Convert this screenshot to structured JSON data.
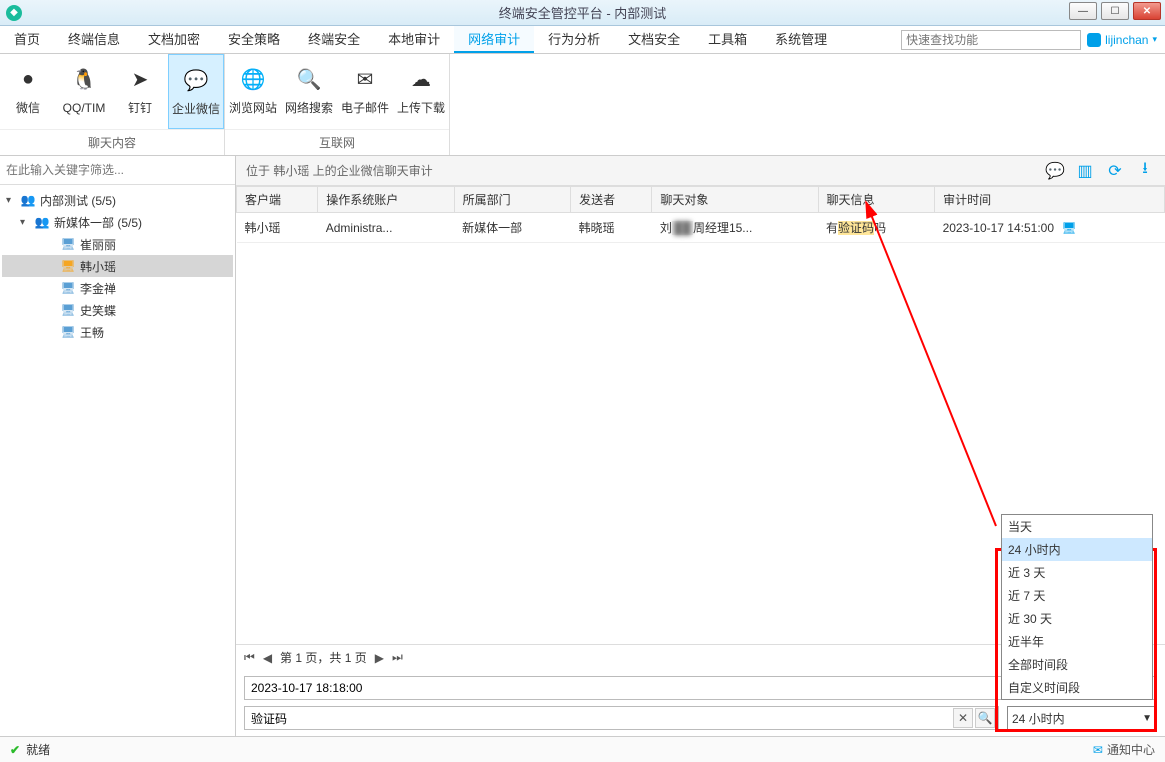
{
  "window": {
    "title": "终端安全管控平台 - 内部测试"
  },
  "menu": {
    "items": [
      "首页",
      "终端信息",
      "文档加密",
      "安全策略",
      "终端安全",
      "本地审计",
      "网络审计",
      "行为分析",
      "文档安全",
      "工具箱",
      "系统管理"
    ],
    "activeIndex": 6,
    "searchPlaceholder": "快速查找功能",
    "user": "lijinchan"
  },
  "ribbon": {
    "group1": {
      "label": "聊天内容",
      "btns": [
        {
          "label": "微信",
          "icon": "●"
        },
        {
          "label": "QQ/TIM",
          "icon": "🐧"
        },
        {
          "label": "钉钉",
          "icon": "➤"
        },
        {
          "label": "企业微信",
          "icon": "💬"
        }
      ],
      "activeIndex": 3
    },
    "group2": {
      "label": "互联网",
      "btns": [
        {
          "label": "浏览网站",
          "icon": "🌐"
        },
        {
          "label": "网络搜索",
          "icon": "🔍"
        },
        {
          "label": "电子邮件",
          "icon": "✉"
        },
        {
          "label": "上传下载",
          "icon": "☁"
        }
      ]
    }
  },
  "sidebar": {
    "filterPlaceholder": "在此输入关键字筛选...",
    "root": {
      "label": "内部测试 (5/5)"
    },
    "dept": {
      "label": "新媒体一部 (5/5)"
    },
    "members": [
      {
        "label": "崔丽丽",
        "icon": "pc"
      },
      {
        "label": "韩小瑶",
        "icon": "pcwarn",
        "selected": true
      },
      {
        "label": "李金禅",
        "icon": "pc"
      },
      {
        "label": "史笑蝶",
        "icon": "pc"
      },
      {
        "label": "王畅",
        "icon": "pc"
      }
    ]
  },
  "path": {
    "text": "位于 韩小瑶 上的企业微信聊天审计"
  },
  "columns": [
    "客户端",
    "操作系统账户",
    "所属部门",
    "发送者",
    "聊天对象",
    "聊天信息",
    "审计时间"
  ],
  "rows": [
    {
      "client": "韩小瑶",
      "os": "Administra...",
      "dept": "新媒体一部",
      "sender": "韩晓瑶",
      "target_prefix": "刘",
      "target_blur": "██",
      "target_suffix": "周经理15...",
      "msg_pre": "有",
      "msg_hl": "验证码",
      "msg_post": "吗",
      "time": "2023-10-17 14:51:00"
    }
  ],
  "pager": {
    "text": "第 1 页，共 1 页"
  },
  "timestamp": {
    "value": "2023-10-17 18:18:00"
  },
  "search2": {
    "value": "验证码"
  },
  "timecombo": {
    "value": "24 小时内",
    "options": [
      "当天",
      "24 小时内",
      "近 3 天",
      "近 7 天",
      "近 30 天",
      "近半年",
      "全部时间段",
      "自定义时间段"
    ],
    "selectedIndex": 1
  },
  "status": {
    "text": "就绪",
    "notify": "通知中心"
  }
}
